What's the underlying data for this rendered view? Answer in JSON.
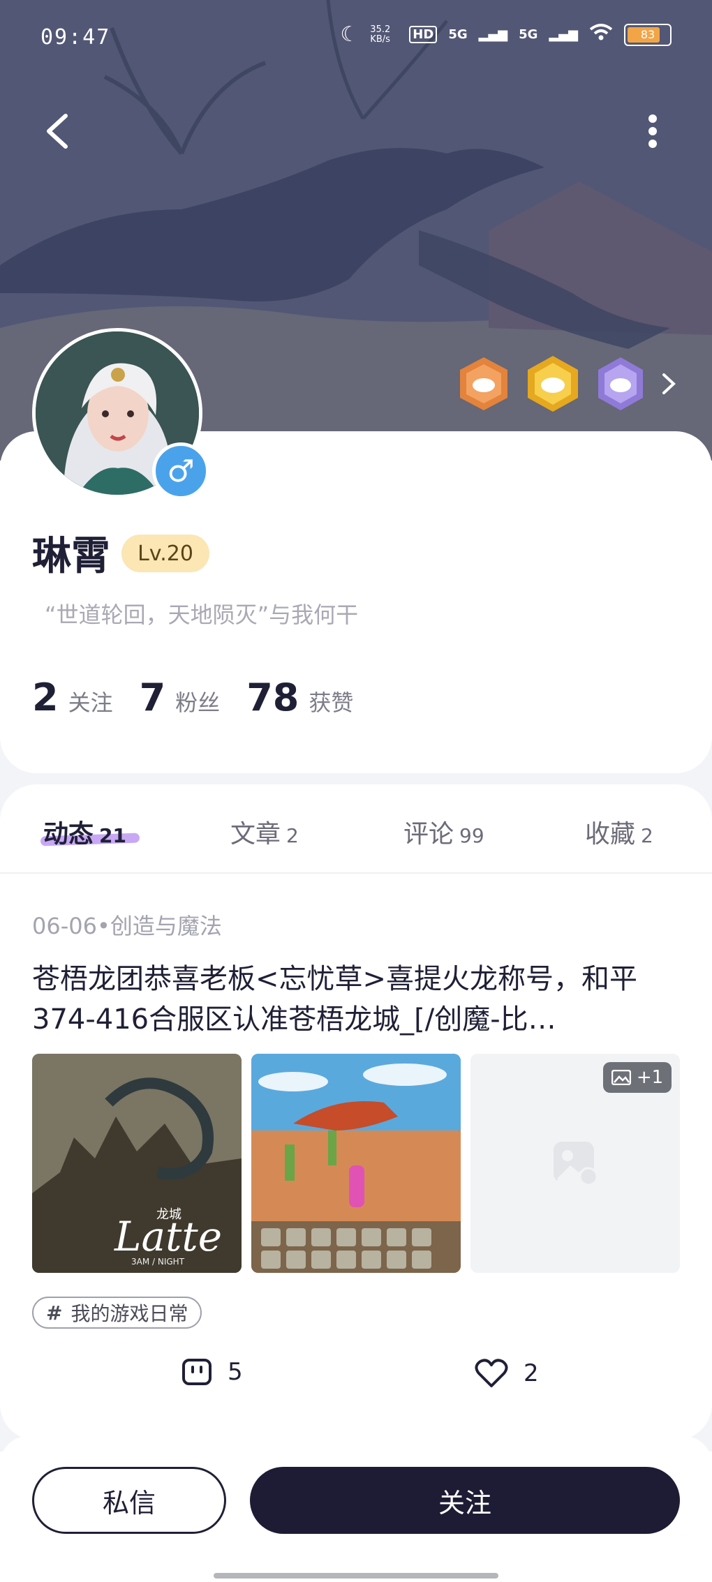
{
  "status_bar": {
    "time": "09:47",
    "net_speed": "35.2 KB/s",
    "hd": "HD",
    "signal1": "5G",
    "signal2": "5G",
    "battery": "83"
  },
  "profile": {
    "name": "琳霄",
    "level": "Lv.20",
    "signature": "“世道轮回，天地陨灭”与我何干",
    "gender_symbol": "♂",
    "stats": [
      {
        "value": "2",
        "label": "关注"
      },
      {
        "value": "7",
        "label": "粉丝"
      },
      {
        "value": "78",
        "label": "获赞"
      }
    ]
  },
  "tabs": [
    {
      "label": "动态",
      "count": "21"
    },
    {
      "label": "文章",
      "count": "2"
    },
    {
      "label": "评论",
      "count": "99"
    },
    {
      "label": "收藏",
      "count": "2"
    }
  ],
  "post": {
    "meta": "06-06•创造与魔法",
    "text": "苍梧龙团恭喜老板<忘忧草>喜提火龙称号，和平374-416合服区认准苍梧龙城_[/创魔-比…",
    "more_images": "+1",
    "img1_title": "龙城",
    "img1_brand": "Latte",
    "img1_sub": "3AM / NIGHT",
    "tag": "我的游戏日常",
    "comments": "5",
    "likes": "2"
  },
  "buttons": {
    "message": "私信",
    "follow": "关注"
  },
  "colors": {
    "accent_dark": "#1d1c34",
    "level_badge": "#fbe6b4",
    "tab_underline": "#c8a8f5",
    "gender": "#4aa3ea"
  }
}
